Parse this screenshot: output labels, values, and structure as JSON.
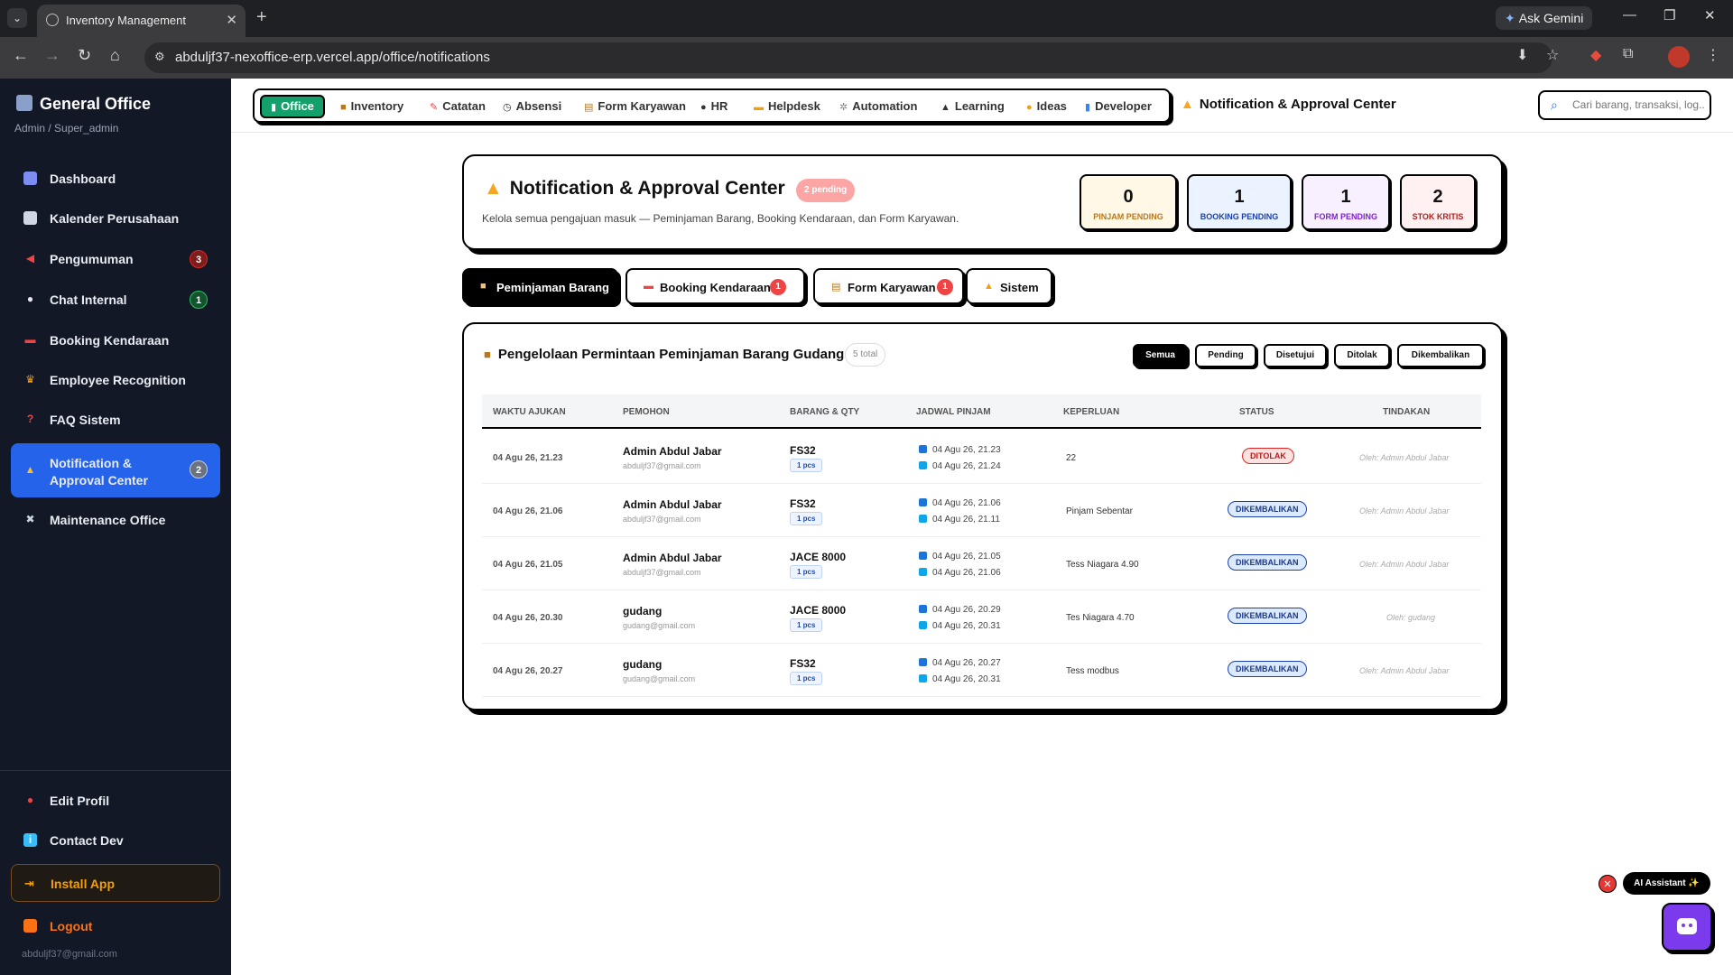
{
  "browser": {
    "tab_title": "Inventory Management",
    "url": "abduljf37-nexoffice-erp.vercel.app/office/notifications",
    "gemini_label": "Ask Gemini"
  },
  "sidebar": {
    "brand": "General Office",
    "role": "Admin / Super_admin",
    "items": [
      {
        "label": "Dashboard",
        "icon": "chart-icon"
      },
      {
        "label": "Kalender Perusahaan",
        "icon": "calendar-icon"
      },
      {
        "label": "Pengumuman",
        "icon": "megaphone-icon",
        "badge": "3"
      },
      {
        "label": "Chat Internal",
        "icon": "chat-icon",
        "badge": "1"
      },
      {
        "label": "Booking Kendaraan",
        "icon": "car-icon"
      },
      {
        "label": "Employee Recognition",
        "icon": "trophy-icon"
      },
      {
        "label": "FAQ Sistem",
        "icon": "question-icon"
      },
      {
        "label": "Notification & Approval Center",
        "icon": "bell-icon",
        "badge": "2"
      },
      {
        "label": "Maintenance Office",
        "icon": "tools-icon"
      }
    ],
    "bottom": {
      "edit_profile": "Edit Profil",
      "contact_dev": "Contact Dev",
      "install_app": "Install App",
      "logout": "Logout",
      "email": "abduljf37@gmail.com"
    }
  },
  "topnav": {
    "items": [
      "Office",
      "Inventory",
      "Catatan",
      "Absensi",
      "Form Karyawan",
      "HR",
      "Helpdesk",
      "Automation",
      "Learning",
      "Ideas",
      "Developer"
    ],
    "current_page": "Notification & Approval Center",
    "search_placeholder": "Cari barang, transaksi, log..."
  },
  "header": {
    "title": "Notification & Approval Center",
    "pending_badge": "2 pending",
    "subtitle": "Kelola semua pengajuan masuk — Peminjaman Barang, Booking Kendaraan, dan Form Karyawan.",
    "stats": [
      {
        "value": "0",
        "label": "PINJAM PENDING",
        "color": "#b7791f",
        "bg": "#fff8e6"
      },
      {
        "value": "1",
        "label": "BOOKING PENDING",
        "color": "#1e40af",
        "bg": "#eaf3ff"
      },
      {
        "value": "1",
        "label": "FORM PENDING",
        "color": "#7e22ce",
        "bg": "#f8f0ff"
      },
      {
        "value": "2",
        "label": "STOK KRITIS",
        "color": "#b91c1c",
        "bg": "#fff1f1"
      }
    ]
  },
  "tabs": [
    {
      "label": "Peminjaman Barang"
    },
    {
      "label": "Booking Kendaraan",
      "badge": "1"
    },
    {
      "label": "Form Karyawan",
      "badge": "1"
    },
    {
      "label": "Sistem"
    }
  ],
  "list": {
    "title": "Pengelolaan Permintaan Peminjaman Barang Gudang",
    "total": "5 total",
    "filters": [
      "Semua",
      "Pending",
      "Disetujui",
      "Ditolak",
      "Dikembalikan"
    ],
    "columns": [
      "WAKTU AJUKAN",
      "PEMOHON",
      "BARANG & QTY",
      "JADWAL PINJAM",
      "KEPERLUAN",
      "STATUS",
      "TINDAKAN"
    ],
    "rows": [
      {
        "time": "04 Agu 26, 21.23",
        "name": "Admin Abdul Jabar",
        "email": "abduljf37@gmail.com",
        "item": "FS32",
        "qty": "1 pcs",
        "start": "04 Agu 26, 21.23",
        "end": "04 Agu 26, 21.24",
        "purpose": "22",
        "status": "DITOLAK",
        "status_type": "red",
        "action": "Oleh: Admin Abdul Jabar"
      },
      {
        "time": "04 Agu 26, 21.06",
        "name": "Admin Abdul Jabar",
        "email": "abduljf37@gmail.com",
        "item": "FS32",
        "qty": "1 pcs",
        "start": "04 Agu 26, 21.06",
        "end": "04 Agu 26, 21.11",
        "purpose": "Pinjam Sebentar",
        "status": "DIKEMBALIKAN",
        "status_type": "blue",
        "action": "Oleh: Admin Abdul Jabar"
      },
      {
        "time": "04 Agu 26, 21.05",
        "name": "Admin Abdul Jabar",
        "email": "abduljf37@gmail.com",
        "item": "JACE 8000",
        "qty": "1 pcs",
        "start": "04 Agu 26, 21.05",
        "end": "04 Agu 26, 21.06",
        "purpose": "Tess Niagara 4.90",
        "status": "DIKEMBALIKAN",
        "status_type": "blue",
        "action": "Oleh: Admin Abdul Jabar"
      },
      {
        "time": "04 Agu 26, 20.30",
        "name": "gudang",
        "email": "gudang@gmail.com",
        "item": "JACE 8000",
        "qty": "1 pcs",
        "start": "04 Agu 26, 20.29",
        "end": "04 Agu 26, 20.31",
        "purpose": "Tes Niagara 4.70",
        "status": "DIKEMBALIKAN",
        "status_type": "blue",
        "action": "Oleh: gudang"
      },
      {
        "time": "04 Agu 26, 20.27",
        "name": "gudang",
        "email": "gudang@gmail.com",
        "item": "FS32",
        "qty": "1 pcs",
        "start": "04 Agu 26, 20.27",
        "end": "04 Agu 26, 20.31",
        "purpose": "Tess modbus",
        "status": "DIKEMBALIKAN",
        "status_type": "blue",
        "action": "Oleh: Admin Abdul Jabar"
      }
    ]
  },
  "assistant": {
    "label": "AI Assistant ✨"
  }
}
